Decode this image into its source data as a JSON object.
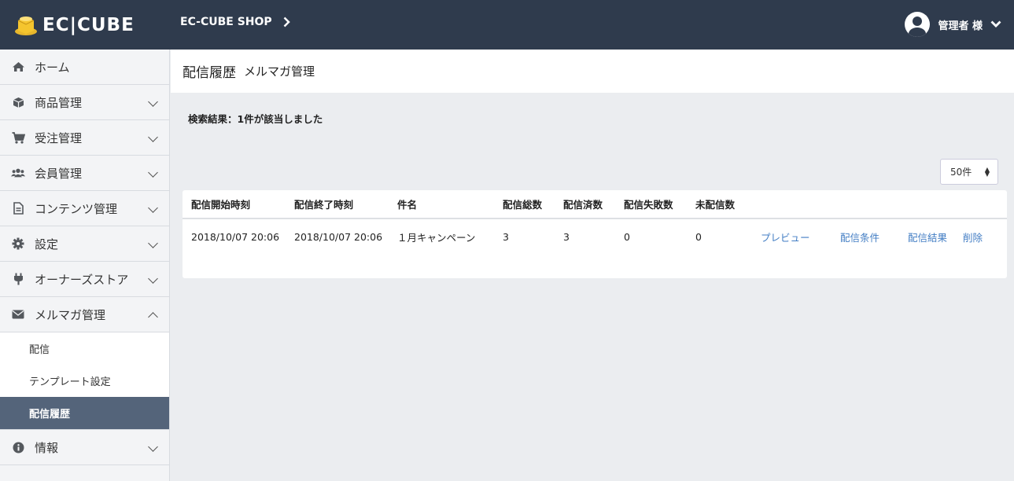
{
  "header": {
    "logo_text": "EC|CUBE",
    "shop_name": "EC-CUBE SHOP",
    "user_label": "管理者 様"
  },
  "sidebar": {
    "items": [
      {
        "label": "ホーム",
        "icon": "home-icon"
      },
      {
        "label": "商品管理",
        "icon": "cube-icon"
      },
      {
        "label": "受注管理",
        "icon": "cart-icon"
      },
      {
        "label": "会員管理",
        "icon": "users-icon"
      },
      {
        "label": "コンテンツ管理",
        "icon": "file-icon"
      },
      {
        "label": "設定",
        "icon": "gear-icon"
      },
      {
        "label": "オーナーズストア",
        "icon": "plug-icon"
      },
      {
        "label": "メルマガ管理",
        "icon": "envelope-icon"
      },
      {
        "label": "情報",
        "icon": "info-icon"
      }
    ],
    "sub_items": [
      {
        "label": "配信"
      },
      {
        "label": "テンプレート設定"
      },
      {
        "label": "配信履歴"
      }
    ]
  },
  "page": {
    "title": "配信履歴",
    "subtitle": "メルマガ管理",
    "result_text": "検索結果：1件が該当しました",
    "per_page": "50件"
  },
  "table": {
    "headers": [
      "配信開始時刻",
      "配信終了時刻",
      "件名",
      "配信総数",
      "配信済数",
      "配信失敗数",
      "未配信数"
    ],
    "rows": [
      {
        "start": "2018/10/07 20:06",
        "end": "2018/10/07 20:06",
        "subject": "１月キャンペーン",
        "total": "3",
        "done": "3",
        "failed": "0",
        "pending": "0",
        "actions": [
          "プレビュー",
          "配信条件",
          "配信結果",
          "削除"
        ]
      }
    ]
  },
  "colors": {
    "header_bg": "#2f3b4d",
    "active_bg": "#54647a",
    "link": "#437ec4"
  }
}
